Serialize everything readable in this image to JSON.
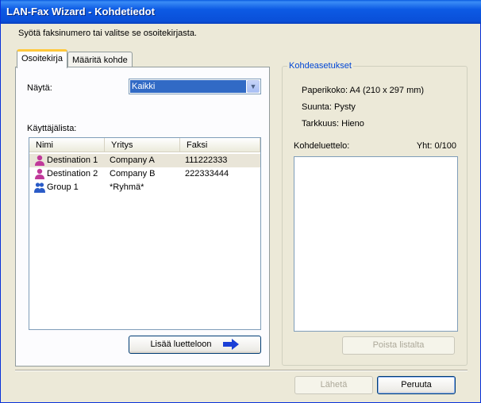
{
  "window": {
    "title": "LAN-Fax Wizard - Kohdetiedot"
  },
  "instruction": "Syötä faksinumero tai valitse se osoitekirjasta.",
  "tabs": [
    {
      "label": "Osoitekirja",
      "active": true
    },
    {
      "label": "Määritä kohde",
      "active": false
    }
  ],
  "addressbook": {
    "show_label": "Näytä:",
    "show_value": "Kaikki",
    "userlist_label": "Käyttäjälista:",
    "columns": [
      "Nimi",
      "Yritys",
      "Faksi"
    ],
    "rows": [
      {
        "icon": "user-icon",
        "name": "Destination 1",
        "company": "Company A",
        "fax": "111222333",
        "selected": true
      },
      {
        "icon": "user-icon",
        "name": "Destination 2",
        "company": "Company B",
        "fax": "222333444",
        "selected": false
      },
      {
        "icon": "group-icon",
        "name": "Group 1",
        "company": "*Ryhmä*",
        "fax": "",
        "selected": false
      }
    ],
    "add_button": "Lisää luetteloon"
  },
  "settings": {
    "group_title": "Kohdeasetukset",
    "paper_size": "Paperikoko: A4 (210 x 297 mm)",
    "orientation": "Suunta: Pysty",
    "resolution": "Tarkkuus: Hieno",
    "destlist_label": "Kohdeluettelo:",
    "total": "Yht: 0/100",
    "remove_button": "Poista listalta"
  },
  "footer": {
    "send_button": "Lähetä",
    "cancel_button": "Peruuta"
  },
  "colors": {
    "titlebar": "#0a4fd8",
    "group_title": "#0046d5",
    "user_icon": "#c0399a",
    "group_icon": "#2a5bc7",
    "arrow": "#1a3fd6"
  }
}
